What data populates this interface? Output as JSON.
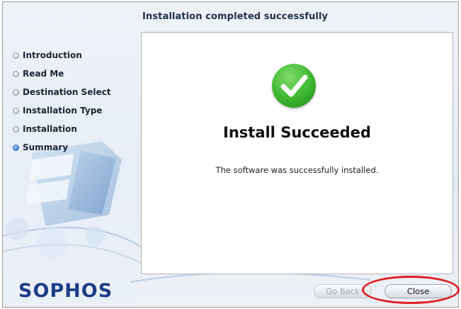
{
  "window": {
    "header_title": "Installation completed successfully"
  },
  "sidebar": {
    "steps": [
      {
        "label": "Introduction",
        "state": "done"
      },
      {
        "label": "Read Me",
        "state": "done"
      },
      {
        "label": "Destination Select",
        "state": "done"
      },
      {
        "label": "Installation Type",
        "state": "done"
      },
      {
        "label": "Installation",
        "state": "done"
      },
      {
        "label": "Summary",
        "state": "current"
      }
    ]
  },
  "content": {
    "status_icon": "checkmark-icon",
    "headline": "Install Succeeded",
    "message": "The software was successfully installed."
  },
  "branding": {
    "logo_text": "SOPHOS"
  },
  "buttons": {
    "go_back_label": "Go Back",
    "go_back_enabled": false,
    "close_label": "Close",
    "close_enabled": true
  },
  "annotation": {
    "type": "red-ellipse-highlight",
    "target": "close-button",
    "color": "#e01e24"
  },
  "colors": {
    "accent_blue": "#3a7fe0",
    "success_green": "#3cb531",
    "logo_blue": "#1d3f86"
  }
}
